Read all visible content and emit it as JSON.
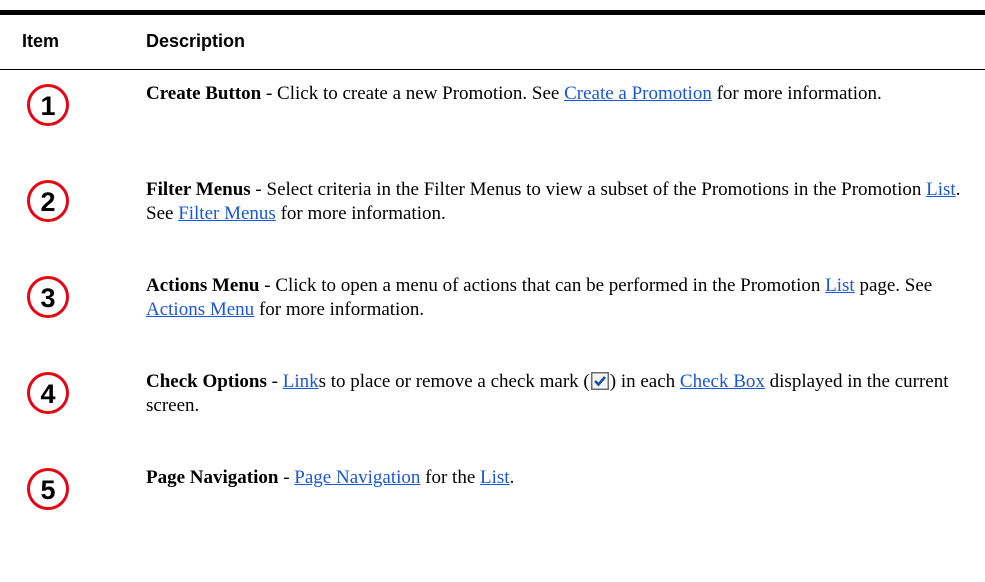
{
  "header": {
    "item": "Item",
    "description": "Description"
  },
  "rows": [
    {
      "number": "1",
      "title": "Create Button",
      "sep": " - ",
      "t1": "Click to create a new Promotion. See ",
      "link1": "Create a Promotion",
      "t2": " for more information."
    },
    {
      "number": "2",
      "title": "Filter Menus",
      "sep": " - ",
      "t1": "Select criteria in the Filter Menus to view a subset of the Promotions in the Promotion ",
      "link1": "List",
      "t2": ". See ",
      "link2": "Filter Menus",
      "t3": " for more information."
    },
    {
      "number": "3",
      "title": "Actions Menu",
      "sep": " - ",
      "t1": "Click to open a menu of actions that can be performed in the Promotion ",
      "link1": "List",
      "t2": " page. See ",
      "link2": "Actions Menu",
      "t3": " for more information."
    },
    {
      "number": "4",
      "title": "Check Options",
      "sep": " - ",
      "link1": "Link",
      "t1": "s to place or remove a check mark (",
      "t2": ") in each ",
      "link2": "Check Box",
      "t3": " displayed in the current screen."
    },
    {
      "number": "5",
      "title": "Page Navigation",
      "sep": " - ",
      "link1": "Page Navigation",
      "t1": " for the ",
      "link2": "List",
      "t2": "."
    }
  ],
  "colors": {
    "circle": "#e30613",
    "link": "#1a57d6"
  },
  "icons": {
    "number": "circled-number-icon",
    "checkbox": "checked-checkbox-icon"
  }
}
